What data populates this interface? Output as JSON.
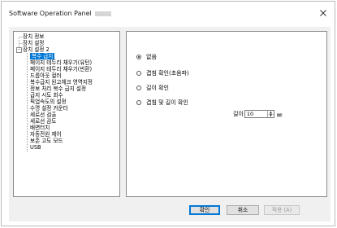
{
  "window": {
    "title": "Software Operation Panel"
  },
  "tree": {
    "root_items": [
      "장치 정보",
      "장치 설정",
      "장치 설정 2"
    ],
    "children": [
      "복수 급지",
      "페이지 테두리 채우기(유턴)",
      "페이지 테두리 채우기(반환)",
      "드롭아웃 컬러",
      "복수급지 원고체크 영역지정",
      "정보 처리 복수 급지 설정",
      "급지 시도 회수",
      "픽업속도의 설정",
      "수명 설정 카운터",
      "세로선 검출",
      "세로선 감도",
      "배면터치",
      "자동전원 제어",
      "보존 고도 모드",
      "USB"
    ],
    "selected": "복수 급지"
  },
  "options": {
    "items": [
      "없음",
      "겹침 확인(초음파)",
      "길이 확인",
      "겹침 및 길이 확인"
    ],
    "selected_index": 0
  },
  "length": {
    "label": "길이",
    "value": "10",
    "unit": "㎜"
  },
  "buttons": {
    "ok": "확인",
    "cancel": "취소",
    "apply": "적용 (A)"
  }
}
